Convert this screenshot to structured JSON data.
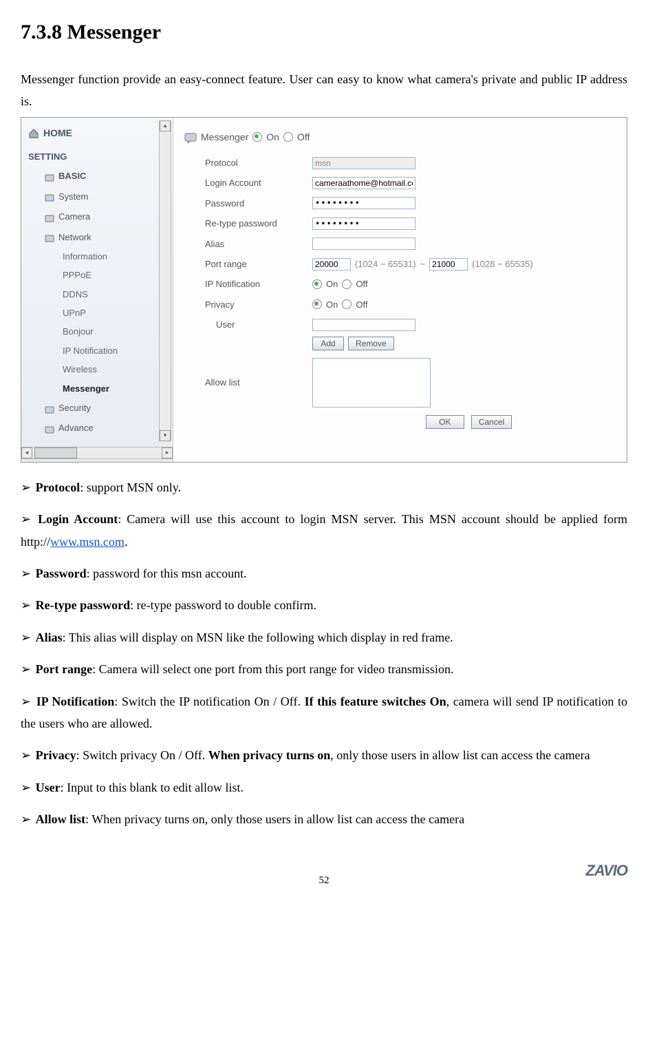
{
  "title": "7.3.8 Messenger",
  "intro": "Messenger function provide an easy-connect feature. User can easy to know what camera's private and public IP address is.",
  "sidebar": {
    "home": "HOME",
    "setting": "SETTING",
    "basic": "BASIC",
    "items": [
      "System",
      "Camera",
      "Network"
    ],
    "subs": [
      "Information",
      "PPPoE",
      "DDNS",
      "UPnP",
      "Bonjour",
      "IP Notification",
      "Wireless",
      "Messenger"
    ],
    "rest": [
      "Security",
      "Advance"
    ]
  },
  "panel": {
    "header": "Messenger",
    "on": "On",
    "off": "Off",
    "rows": {
      "protocol": "Protocol",
      "protocol_val": "msn",
      "login": "Login Account",
      "login_val": "cameraathome@hotmail.com",
      "password": "Password",
      "password_val": "••••••••",
      "retype": "Re-type password",
      "retype_val": "••••••••",
      "alias": "Alias",
      "alias_val": "",
      "portrange": "Port range",
      "port_from": "20000",
      "port_from_hint": "(1024 ~ 65531)",
      "tilde": "~",
      "port_to": "21000",
      "port_to_hint": "(1028 ~ 65535)",
      "ipnotif": "IP Notification",
      "privacy": "Privacy",
      "user": "User",
      "user_val": "",
      "add": "Add",
      "remove": "Remove",
      "allowlist": "Allow list",
      "ok": "OK",
      "cancel": "Cancel"
    }
  },
  "bullets": [
    {
      "label": "Protocol",
      "text": ": support MSN only."
    },
    {
      "label": "Login Account",
      "text": ": Camera will use this account to login MSN server. This MSN account should be applied form http://",
      "link": "www.msn.com",
      "after": "."
    },
    {
      "label": "Password",
      "text": ": password for this msn account."
    },
    {
      "label": "Re-type password",
      "text": ": re-type password to double confirm."
    },
    {
      "label": "Alias",
      "text": ": This alias will display on MSN like the following which display in red frame."
    },
    {
      "label": "Port range",
      "text": ": Camera will select one port from this port range for video transmission."
    },
    {
      "label": "IP Notification",
      "text_before": ": Switch the IP notification On / Off. ",
      "bold": "If this feature switches On",
      "text_after": ", camera will send IP notification to the users who are allowed."
    },
    {
      "label": "Privacy",
      "text_before": ": Switch privacy On / Off. ",
      "bold": "When privacy turns on",
      "text_after": ", only those users in allow list can access the camera"
    },
    {
      "label": "User",
      "text": ": Input to this blank to edit allow list."
    },
    {
      "label": "Allow list",
      "text": ": When privacy turns on, only those users in allow list can access the camera"
    }
  ],
  "page_number": "52",
  "footer_logo": "ZAVIO"
}
